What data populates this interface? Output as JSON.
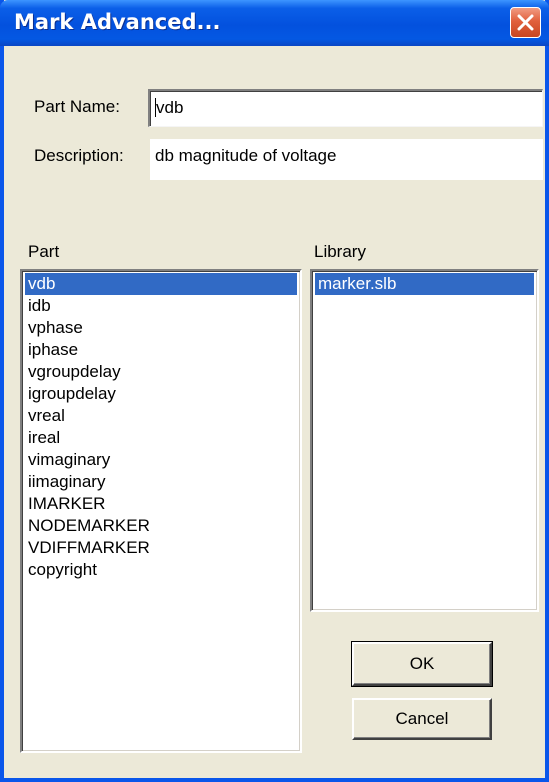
{
  "window": {
    "title": "Mark Advanced..."
  },
  "form": {
    "part_name_label": "Part Name:",
    "part_name_value": "vdb",
    "description_label": "Description:",
    "description_value": "db magnitude of voltage"
  },
  "part_list": {
    "header": "Part",
    "selected": "vdb",
    "items": [
      "vdb",
      "idb",
      "vphase",
      "iphase",
      "vgroupdelay",
      "igroupdelay",
      "vreal",
      "ireal",
      "vimaginary",
      "iimaginary",
      "IMARKER",
      "NODEMARKER",
      "VDIFFMARKER",
      "copyright"
    ]
  },
  "library_list": {
    "header": "Library",
    "selected": "marker.slb",
    "items": [
      "marker.slb"
    ]
  },
  "buttons": {
    "ok": "OK",
    "cancel": "Cancel"
  },
  "colors": {
    "titlebar": "#0351de",
    "selection": "#316ac5",
    "dialog_bg": "#ece9d8",
    "close_button": "#e1603d"
  },
  "icons": {
    "close": "close-x-icon"
  }
}
